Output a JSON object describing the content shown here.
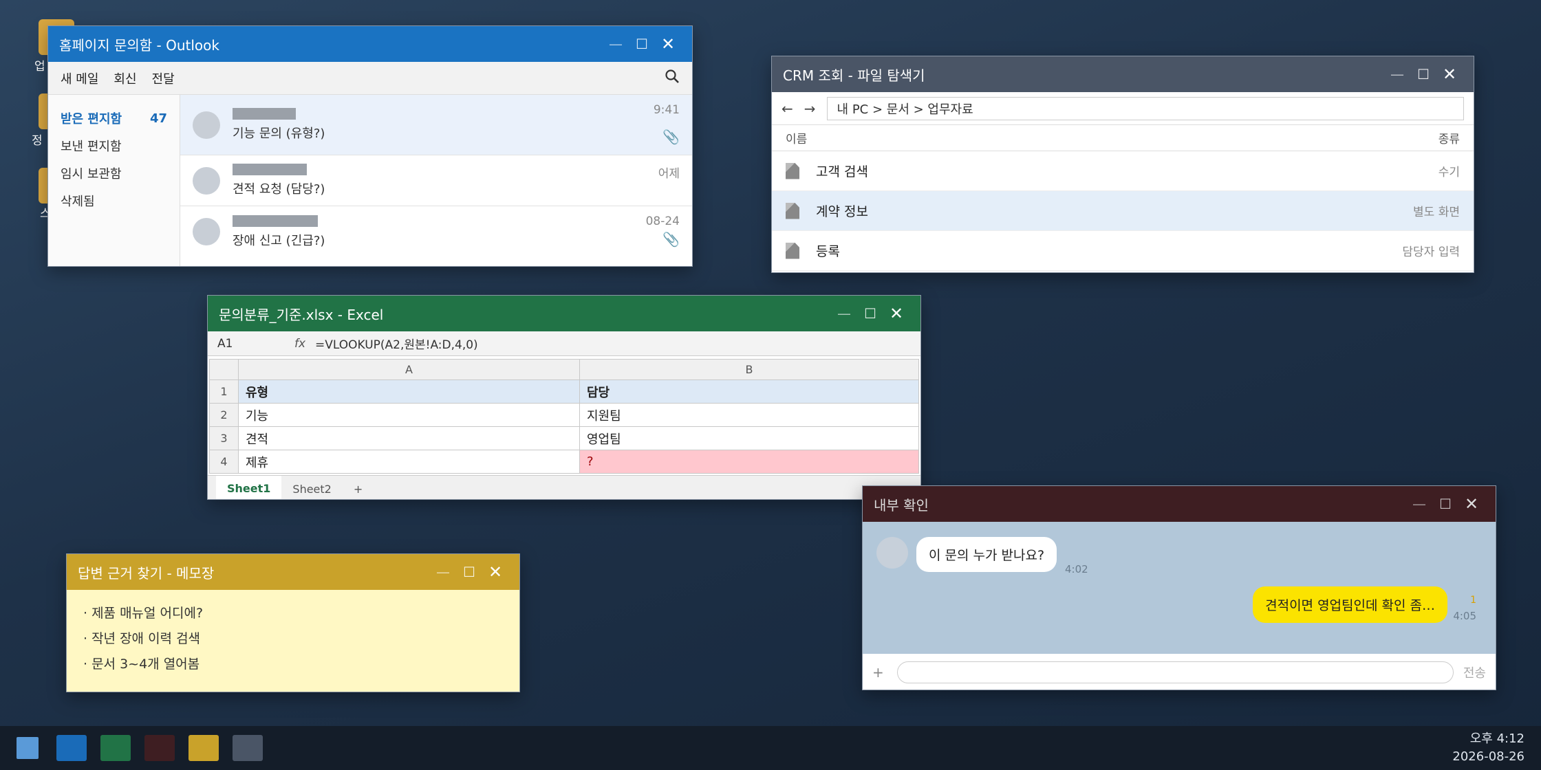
{
  "desktop": {
    "icons": [
      {
        "label": "업"
      },
      {
        "label": "정"
      },
      {
        "label": "스"
      }
    ]
  },
  "outlook": {
    "title": "홈페이지 문의함 - Outlook",
    "toolbar": {
      "new_mail": "새 메일",
      "reply": "회신",
      "forward": "전달"
    },
    "folders": [
      {
        "label": "받은 편지함",
        "count": "47"
      },
      {
        "label": "보낸 편지함"
      },
      {
        "label": "임시 보관함"
      },
      {
        "label": "삭제됨"
      }
    ],
    "messages": [
      {
        "subject": "기능 문의 (유형?)",
        "time": "9:41",
        "attachment": true
      },
      {
        "subject": "견적 요청 (담당?)",
        "time": "어제",
        "attachment": false
      },
      {
        "subject": "장애 신고 (긴급?)",
        "time": "08-24",
        "attachment": true
      }
    ]
  },
  "explorer": {
    "title": "CRM 조회 - 파일 탐색기",
    "path": "내 PC > 문서 > 업무자료",
    "columns": {
      "name": "이름",
      "type": "종류"
    },
    "rows": [
      {
        "name": "고객 검색",
        "type": "수기"
      },
      {
        "name": "계약 정보",
        "type": "별도 화면"
      },
      {
        "name": "등록",
        "type": "담당자 입력"
      }
    ]
  },
  "excel": {
    "title": "문의분류_기준.xlsx - Excel",
    "cell_ref": "A1",
    "fx": "fx",
    "formula": "=VLOOKUP(A2,원본!A:D,4,0)",
    "columns": [
      "A",
      "B"
    ],
    "rows": [
      {
        "num": "1",
        "a": "유형",
        "b": "담당"
      },
      {
        "num": "2",
        "a": "기능",
        "b": "지원팀"
      },
      {
        "num": "3",
        "a": "견적",
        "b": "영업팀"
      },
      {
        "num": "4",
        "a": "제휴",
        "b": "?"
      }
    ],
    "sheets": [
      "Sheet1",
      "Sheet2"
    ],
    "add_sheet": "+"
  },
  "chat": {
    "title": "내부 확인",
    "messages": [
      {
        "text": "이 문의 누가 받나요?",
        "time": "4:02",
        "direction": "in"
      },
      {
        "text": "견적이면 영업팀인데 확인 좀…",
        "time": "4:05",
        "read": "1",
        "direction": "out"
      }
    ],
    "plus": "+",
    "send": "전송"
  },
  "notepad": {
    "title": "답변 근거 찾기 - 메모장",
    "lines": [
      "· 제품 매뉴얼 어디에?",
      "· 작년 장애 이력 검색",
      "· 문서 3~4개 열어봄"
    ]
  },
  "taskbar": {
    "apps": [
      {
        "color": "#1a6bb8"
      },
      {
        "color": "#217346"
      },
      {
        "color": "#3e1e22"
      },
      {
        "color": "#c9a22a"
      },
      {
        "color": "#4a5566"
      }
    ],
    "time": "오후 4:12",
    "date": "2026-08-26"
  },
  "icons": {
    "search": "search-icon",
    "attachment": "paperclip-icon",
    "file": "file-icon",
    "back": "arrow-left-icon",
    "forward": "arrow-right-icon"
  }
}
